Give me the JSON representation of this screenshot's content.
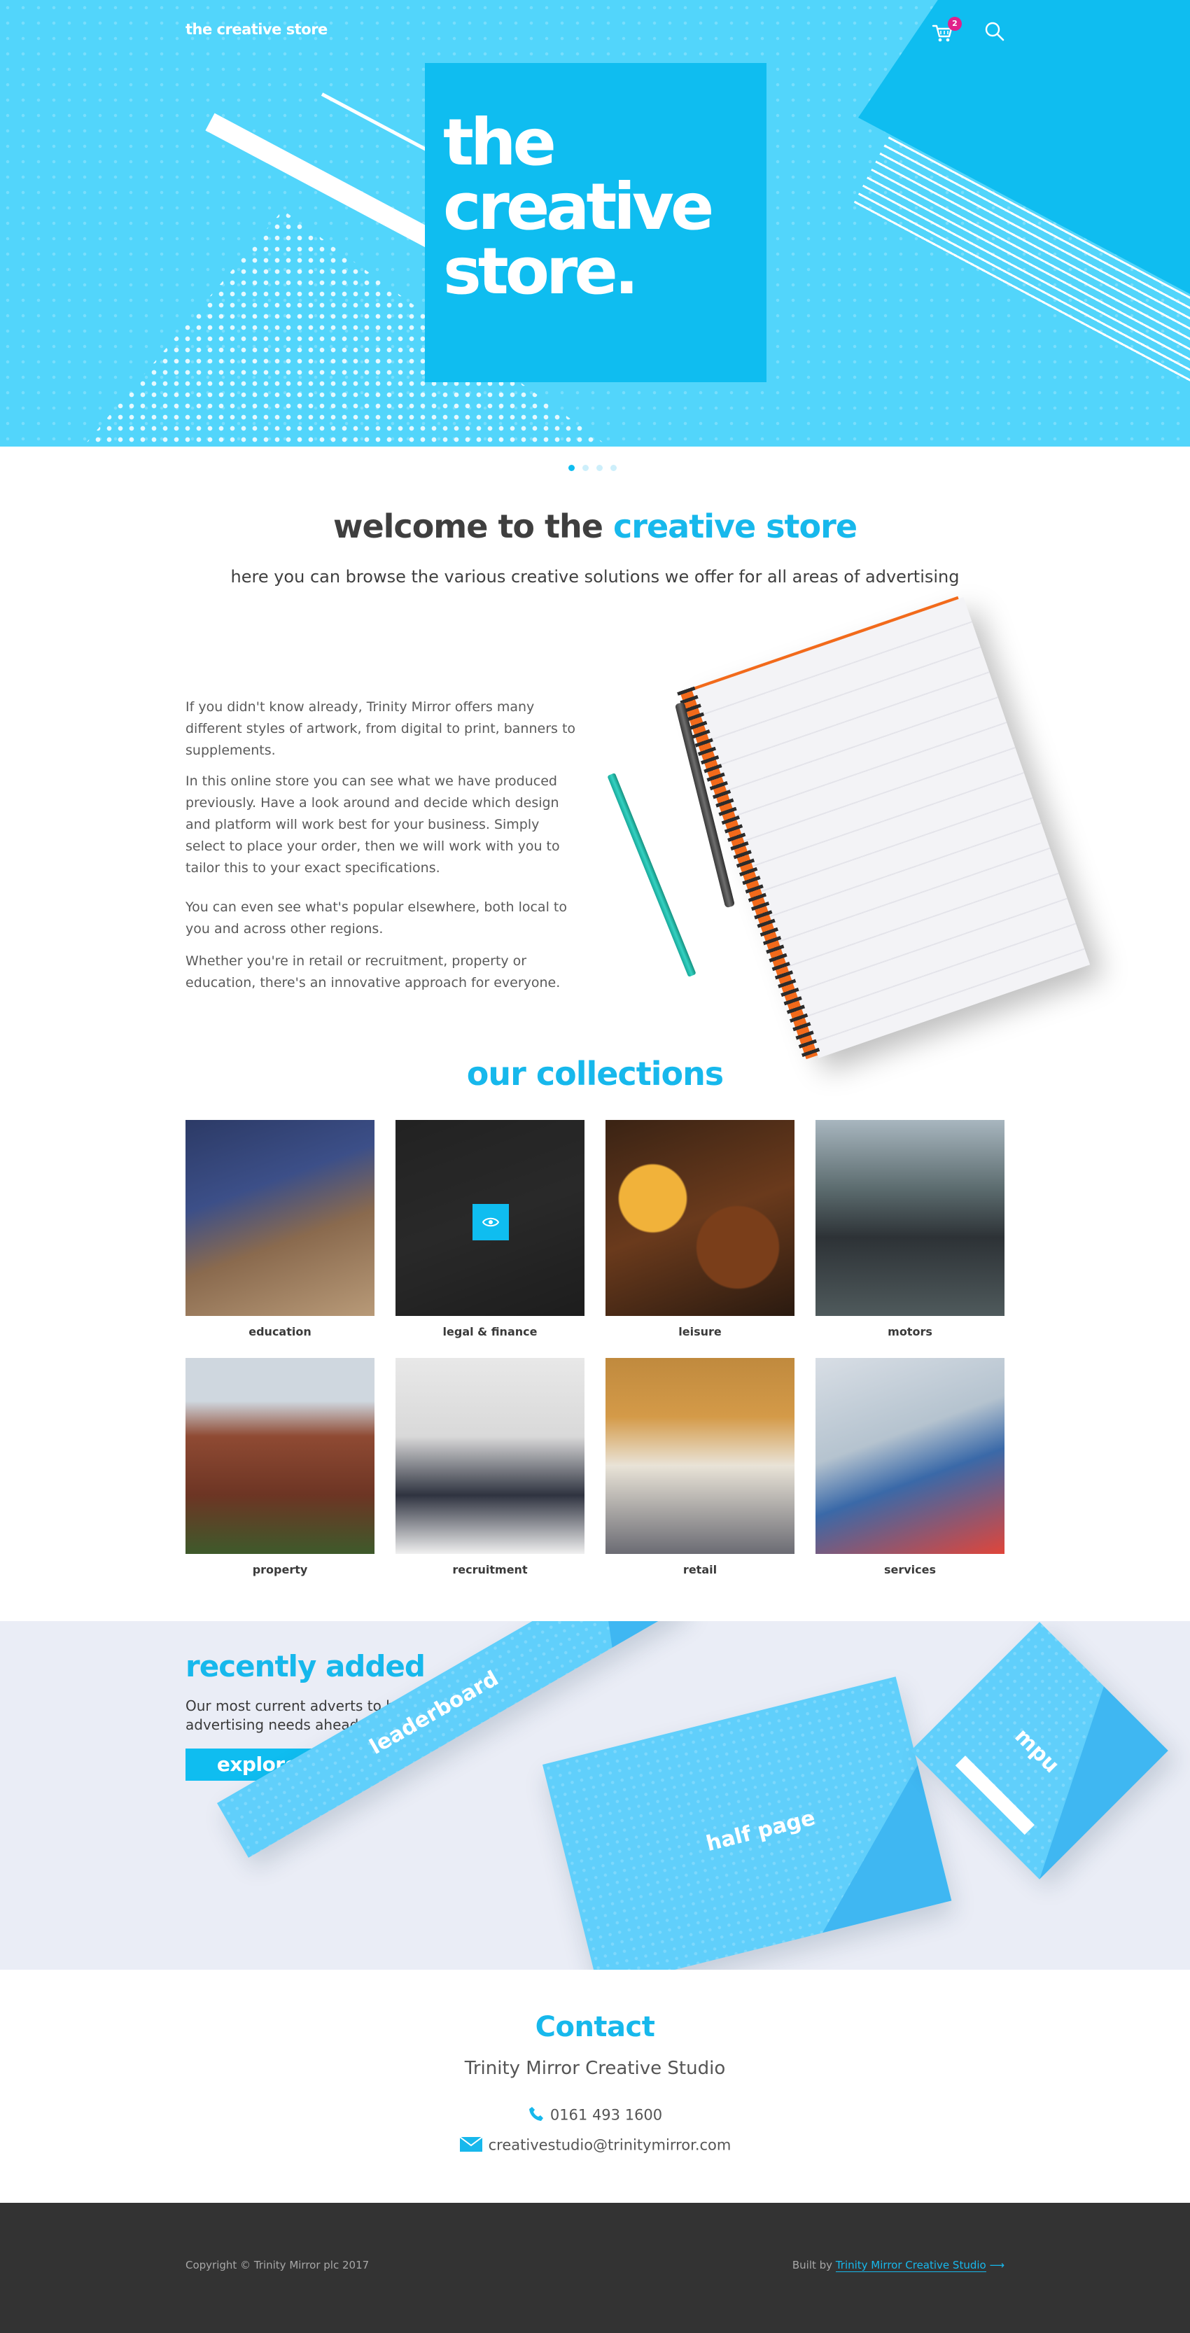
{
  "header": {
    "brand": "the creative store",
    "cart_count": "2",
    "hero_headline": "the\ncreative\nstore."
  },
  "slider": {
    "dots": 4,
    "active": 1
  },
  "welcome": {
    "title_plain": "welcome to the ",
    "title_highlight": "creative store",
    "subtitle": "here you can browse the various creative solutions we offer for all areas of advertising"
  },
  "intro": {
    "paragraphs": [
      "If you didn't know already, Trinity Mirror offers many different styles of artwork, from digital to print, banners to supplements.",
      "In this online store you can see what we have produced previously. Have a look around and decide which design and platform will work best for your business. Simply select to place your order, then we will work with you to tailor this to your exact specifications.",
      "You can even see what's popular elsewhere, both local to you and across other regions.",
      "Whether you're in retail or recruitment, property or education, there's an innovative approach for everyone."
    ]
  },
  "collections": {
    "title": "our collections",
    "items": [
      {
        "label": "education"
      },
      {
        "label": "legal & finance"
      },
      {
        "label": "leisure"
      },
      {
        "label": "motors"
      },
      {
        "label": "property"
      },
      {
        "label": "recruitment"
      },
      {
        "label": "retail"
      },
      {
        "label": "services"
      }
    ]
  },
  "recent": {
    "title": "recently added",
    "text": "Our most current adverts to help keep your advertising needs ahead of the curve.",
    "button": "explore",
    "cards": [
      "leaderboard",
      "half page",
      "mpu"
    ]
  },
  "contact": {
    "title": "Contact",
    "org": "Trinity Mirror Creative Studio",
    "phone": "0161 493 1600",
    "email": "creativestudio@trinitymirror.com"
  },
  "footer": {
    "copyright": "Copyright © Trinity Mirror plc 2017",
    "built_prefix": "Built by ",
    "built_link": "Trinity Mirror Creative Studio"
  },
  "colors": {
    "accent": "#17b8ec",
    "hero_bg": "#52d5fb",
    "badge": "#e0218a",
    "footer_bg": "#333333"
  }
}
